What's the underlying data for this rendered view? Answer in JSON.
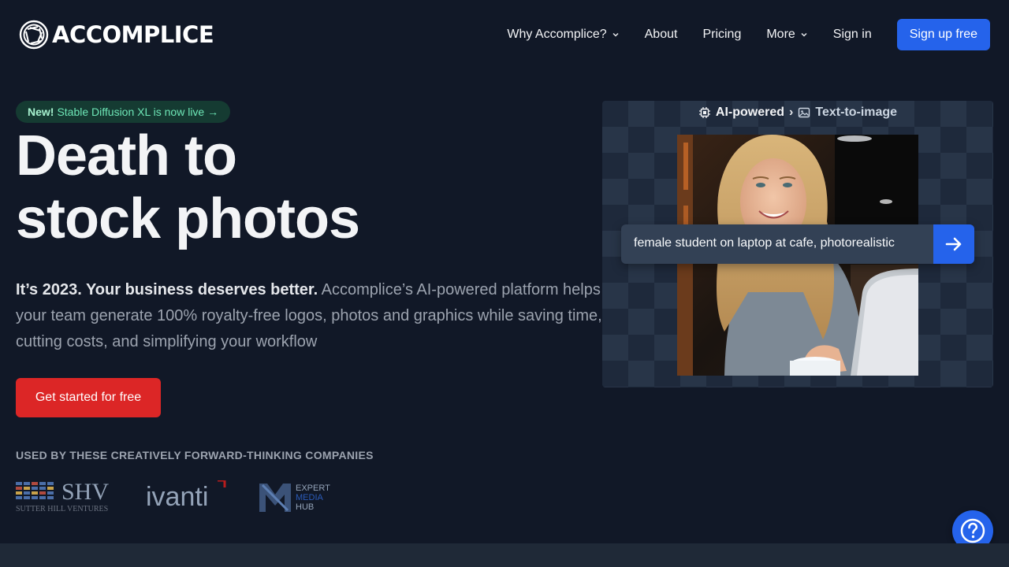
{
  "brand": {
    "name": "ACCOMPLICE",
    "logo_icon": "aperture-logo-icon"
  },
  "nav": {
    "items": [
      {
        "label": "Why Accomplice?",
        "has_dropdown": true
      },
      {
        "label": "About",
        "has_dropdown": false
      },
      {
        "label": "Pricing",
        "has_dropdown": false
      },
      {
        "label": "More",
        "has_dropdown": true
      },
      {
        "label": "Sign in",
        "has_dropdown": false
      }
    ],
    "signup_label": "Sign up free"
  },
  "announcement": {
    "badge": "New!",
    "text": "Stable Diffusion XL is now live →"
  },
  "hero": {
    "title_line1": "Death to",
    "title_line2": "stock photos",
    "lead_strong": "It’s 2023. Your business deserves better.",
    "lead_text": " Accomplice’s AI-powered platform helps your team generate 100% royalty-free logos, photos and graphics while saving time, cutting costs, and simplifying your workflow",
    "cta_label": "Get started for free"
  },
  "customers": {
    "heading": "USED BY THESE CREATIVELY FORWARD-THINKING COMPANIES",
    "logos": [
      {
        "name": "SHV",
        "subtitle": "SUTTER HILL VENTURES"
      },
      {
        "name": "ivanti"
      },
      {
        "name": "EXPERT MEDIA HUB",
        "lines": [
          "EXPERT",
          "MEDIA",
          "HUB"
        ]
      }
    ]
  },
  "demo": {
    "breadcrumb": [
      {
        "label": "AI-powered",
        "icon": "chip-icon"
      },
      {
        "label": "Text-to-image",
        "icon": "image-icon"
      }
    ],
    "prompt_text": "female student on laptop at cafe, photorealistic",
    "submit_icon": "arrow-right-icon"
  },
  "help": {
    "icon": "question-circle-icon"
  },
  "colors": {
    "background": "#111827",
    "primary": "#2563eb",
    "cta": "#dc2626",
    "announcement_bg": "#153b32",
    "announcement_text": "#6ee7b7"
  }
}
